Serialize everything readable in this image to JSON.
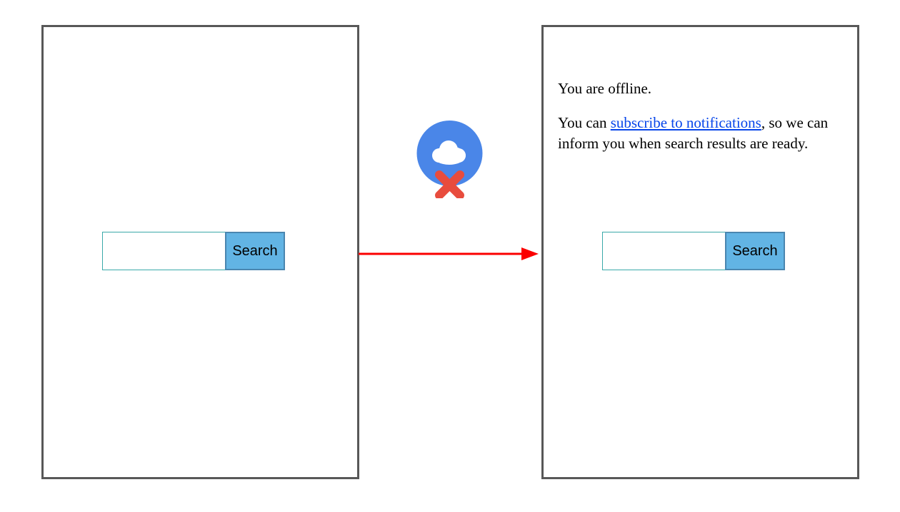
{
  "left_panel": {
    "search": {
      "input_value": "",
      "button_label": "Search"
    }
  },
  "right_panel": {
    "message_line1": "You are offline.",
    "message_line2_pre": "You can ",
    "message_link": "subscribe to notifications",
    "message_line2_post": ", so we can inform you when search results are ready.",
    "search": {
      "input_value": "",
      "button_label": "Search"
    }
  },
  "icons": {
    "cloud_offline": "cloud-offline",
    "transition_arrow": "arrow-right"
  },
  "colors": {
    "panel_border": "#585858",
    "input_border": "#3aa9a9",
    "button_bg": "#62b4e4",
    "button_border": "#4a86b0",
    "link": "#0645ea",
    "arrow": "#fb0000",
    "cloud_circle": "#4a86e8",
    "cloud_fill": "#ffffff",
    "x_mark": "#e84c3d"
  }
}
